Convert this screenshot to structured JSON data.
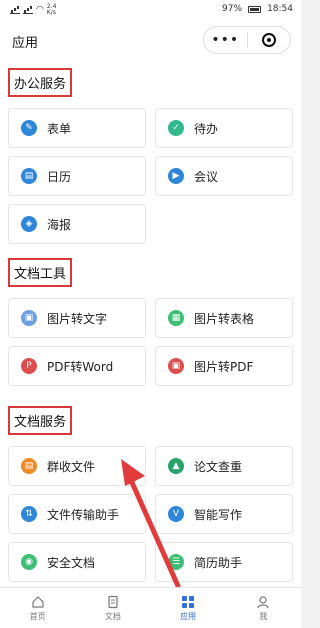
{
  "status": {
    "time": "18:54",
    "battery": "97%",
    "net_speed_top": "2.4",
    "net_speed_bottom": "K/s"
  },
  "header": {
    "title": "应用",
    "more_glyph": "•••"
  },
  "sections": [
    {
      "title": "办公服务",
      "items": [
        "表单",
        "待办",
        "日历",
        "会议",
        "海报"
      ]
    },
    {
      "title": "文档工具",
      "items": [
        "图片转文字",
        "图片转表格",
        "PDF转Word",
        "图片转PDF"
      ]
    },
    {
      "title": "文档服务",
      "items": [
        "群收文件",
        "论文查重",
        "文件传输助手",
        "智能写作",
        "安全文档",
        "简历助手"
      ]
    }
  ],
  "icons": {
    "form": {
      "color": "#2d86d9",
      "glyph": "✎"
    },
    "todo": {
      "color": "#31b98a",
      "glyph": "✓"
    },
    "calendar": {
      "color": "#2d86d9",
      "glyph": "▤"
    },
    "meeting": {
      "color": "#2d86d9",
      "glyph": "▶"
    },
    "poster": {
      "color": "#2d86d9",
      "glyph": "◈"
    },
    "img2text": {
      "color": "#6d9fe5",
      "glyph": "▣"
    },
    "img2table": {
      "color": "#3cbf75",
      "glyph": "▦"
    },
    "pdf2word": {
      "color": "#e04d4d",
      "glyph": "P"
    },
    "img2pdf": {
      "color": "#e04d4d",
      "glyph": "▣"
    },
    "group": {
      "color": "#f08a24",
      "glyph": "▤"
    },
    "plagiarism": {
      "color": "#2aa36b",
      "glyph": "▲"
    },
    "transfer": {
      "color": "#2d86d9",
      "glyph": "⇅"
    },
    "writing": {
      "color": "#2d86d9",
      "glyph": "V"
    },
    "secure": {
      "color": "#3cbf75",
      "glyph": "◉"
    },
    "resume": {
      "color": "#3cbf75",
      "glyph": "☰"
    }
  },
  "tabs": [
    {
      "label": "首页",
      "active": false
    },
    {
      "label": "文档",
      "active": false
    },
    {
      "label": "应用",
      "active": true
    },
    {
      "label": "我",
      "active": false
    }
  ],
  "colors": {
    "accent": "#2f6fe0",
    "highlight_box": "#d83a3a",
    "arrow": "#e23b3b"
  }
}
